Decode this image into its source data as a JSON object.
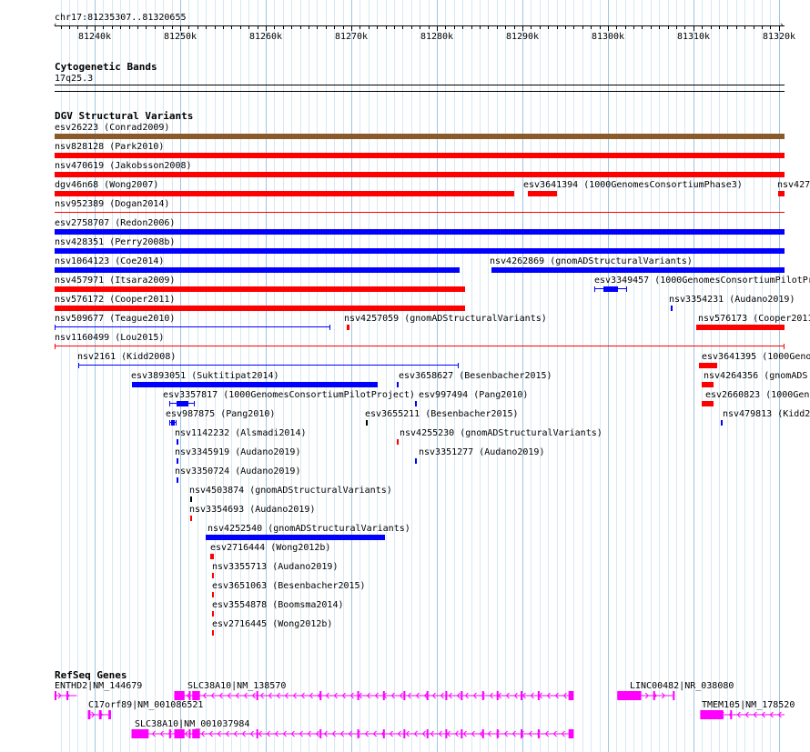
{
  "ruler": {
    "coords": "chr17:81235307..81320655",
    "start": 81235307,
    "end": 81320655,
    "ticks": [
      "81240k",
      "81250k",
      "81260k",
      "81270k",
      "81280k",
      "81290k",
      "81300k",
      "81310k",
      "81320k"
    ]
  },
  "cytobands": {
    "title": "Cytogenetic Bands",
    "band": "17q25.3"
  },
  "dgv": {
    "title": "DGV Structural Variants",
    "colors": {
      "brown": "#8b5a2b",
      "red": "#ff0000",
      "blue": "#0000ff"
    },
    "items": [
      {
        "label": "esv26223 (Conrad2009)",
        "color": "brown",
        "start": 81235307,
        "end": 81320655
      },
      {
        "label": "nsv828128 (Park2010)",
        "color": "red",
        "start": 81235307,
        "end": 81320655
      },
      {
        "label": "nsv470619 (Jakobsson2008)",
        "color": "red",
        "start": 81235307,
        "end": 81320655
      },
      {
        "label": "dgv46n68 (Wong2007)",
        "color": "red",
        "start": 81235307,
        "end": 81289100
      },
      {
        "label": "esv3641394 (1000GenomesConsortiumPhase3)",
        "color": "red",
        "start": 81290600,
        "end": 81294100
      },
      {
        "label": "nsv427",
        "color": "red",
        "start": 81319900,
        "end": 81320655
      },
      {
        "label": "nsv952389 (Dogan2014)",
        "color": "red",
        "style": "thin",
        "start": 81235307,
        "end": 81320655
      },
      {
        "label": "esv2758707 (Redon2006)",
        "color": "blue",
        "start": 81235307,
        "end": 81320655
      },
      {
        "label": "nsv428351 (Perry2008b)",
        "color": "blue",
        "start": 81235307,
        "end": 81320655
      },
      {
        "label": "nsv1064123 (Coe2014)",
        "color": "blue",
        "start": 81235307,
        "end": 81282700
      },
      {
        "label": "nsv4262869 (gnomADStructuralVariants)",
        "color": "blue",
        "start": 81286400,
        "end": 81320655
      },
      {
        "label": "nsv457971 (Itsara2009)",
        "color": "red",
        "start": 81235307,
        "end": 81283300
      },
      {
        "label": "esv3349457 (1000GenomesConsortiumPilotPr",
        "color": "blue",
        "style": "dumbbell",
        "start": 81298400,
        "end": 81302200
      },
      {
        "label": "nsv576172 (Cooper2011)",
        "color": "red",
        "start": 81235307,
        "end": 81283300
      },
      {
        "label": "nsv3354231 (Audano2019)",
        "color": "blue",
        "start": 81307400,
        "end": 81307600
      },
      {
        "label": "nsv509677 (Teague2010)",
        "color": "blue",
        "style": "dumbbell",
        "start": 81235307,
        "end": 81267600
      },
      {
        "label": "nsv4257059 (gnomADStructuralVariants)",
        "color": "red",
        "start": 81269500,
        "end": 81269800
      },
      {
        "label": "nsv576173 (Cooper2011",
        "color": "red",
        "start": 81310300,
        "end": 81320655
      },
      {
        "label": "nsv1160499 (Lou2015)",
        "color": "red",
        "style": "dumbbell",
        "start": 81235307,
        "end": 81320655
      },
      {
        "label": "nsv2161 (Kidd2008)",
        "color": "blue",
        "style": "dumbbell",
        "start": 81238100,
        "end": 81282600
      },
      {
        "label": "esv3641395 (1000Geno",
        "color": "red",
        "start": 81310700,
        "end": 81312800
      },
      {
        "label": "esv3893051 (Suktitipat2014)",
        "color": "blue",
        "start": 81244400,
        "end": 81273100
      },
      {
        "label": "esv3658627 (Besenbacher2015)",
        "color": "blue",
        "start": 81275300,
        "end": 81275500
      },
      {
        "label": "nsv4264356 (gnomADS",
        "color": "red",
        "start": 81311000,
        "end": 81312400
      },
      {
        "label": "esv3357817 (1000GenomesConsortiumPilotProject)",
        "color": "blue",
        "style": "dumbbell",
        "start": 81248700,
        "end": 81251700
      },
      {
        "label": "esv997494 (Pang2010)",
        "color": "blue",
        "start": 81277500,
        "end": 81277700
      },
      {
        "label": "esv2660823 (1000Geno",
        "color": "red",
        "start": 81311000,
        "end": 81312400
      },
      {
        "label": "esv987875 (Pang2010)",
        "color": "blue",
        "style": "dumbbell",
        "start": 81248700,
        "end": 81249600
      },
      {
        "label": "esv3655211 (Besenbacher2015)",
        "color": "black",
        "start": 81271700,
        "end": 81271900
      },
      {
        "label": "nsv479813 (Kidd2",
        "color": "blue",
        "start": 81313200,
        "end": 81313400
      },
      {
        "label": "nsv1142232 (Alsmadi2014)",
        "color": "blue",
        "start": 81249600,
        "end": 81249800
      },
      {
        "label": "nsv4255230 (gnomADStructuralVariants)",
        "color": "red",
        "start": 81275300,
        "end": 81275500
      },
      {
        "label": "nsv3345919 (Audano2019)",
        "color": "blue",
        "start": 81249600,
        "end": 81249800
      },
      {
        "label": "nsv3351277 (Audano2019)",
        "color": "blue",
        "start": 81277500,
        "end": 81277700
      },
      {
        "label": "nsv3350724 (Audano2019)",
        "color": "blue",
        "start": 81249600,
        "end": 81249800
      },
      {
        "label": "nsv4503874 (gnomADStructuralVariants)",
        "color": "black",
        "start": 81251200,
        "end": 81251400
      },
      {
        "label": "nsv3354693 (Audano2019)",
        "color": "red",
        "start": 81251200,
        "end": 81251400
      },
      {
        "label": "nsv4252540 (gnomADStructuralVariants)",
        "color": "blue",
        "start": 81253000,
        "end": 81273900
      },
      {
        "label": "esv2716444 (Wong2012b)",
        "color": "red",
        "style": "dumbbell",
        "start": 81253500,
        "end": 81253900
      },
      {
        "label": "nsv3355713 (Audano2019)",
        "color": "red",
        "start": 81253700,
        "end": 81253900
      },
      {
        "label": "esv3651063 (Besenbacher2015)",
        "color": "red",
        "start": 81253700,
        "end": 81253900
      },
      {
        "label": "esv3554878 (Boomsma2014)",
        "color": "red",
        "start": 81253700,
        "end": 81253900
      },
      {
        "label": "esv2716445 (Wong2012b)",
        "color": "red",
        "start": 81253700,
        "end": 81253900
      }
    ]
  },
  "refseq": {
    "title": "RefSeq Genes",
    "color": "#ff00ff",
    "genes": [
      {
        "label": "ENTHD2|NM_144679",
        "start": 81235307,
        "end": 81237900,
        "strand": "+",
        "exons": [
          [
            81235307,
            81235500
          ],
          [
            81236700,
            81236900
          ]
        ]
      },
      {
        "label": "SLC38A10|NM_138570",
        "start": 81249300,
        "end": 81296000,
        "strand": "-",
        "exons": [
          [
            81249300,
            81250500
          ],
          [
            81251000,
            81251200
          ],
          [
            81251400,
            81252300
          ],
          [
            81258900,
            81259100
          ],
          [
            81266300,
            81266500
          ],
          [
            81270700,
            81270900
          ],
          [
            81273700,
            81273900
          ],
          [
            81276100,
            81276300
          ],
          [
            81278800,
            81279000
          ],
          [
            81281000,
            81281200
          ],
          [
            81282800,
            81283000
          ],
          [
            81285300,
            81285500
          ],
          [
            81287000,
            81287200
          ],
          [
            81289800,
            81290000
          ],
          [
            81291800,
            81292000
          ],
          [
            81295400,
            81296000
          ]
        ]
      },
      {
        "label": "LINC00482|NR_038080",
        "start": 81301100,
        "end": 81307800,
        "strand": "+",
        "exons": [
          [
            81301100,
            81303900
          ],
          [
            81305300,
            81305500
          ],
          [
            81307600,
            81307800
          ]
        ]
      },
      {
        "label": "C17orf89|NM_001086521",
        "start": 81239200,
        "end": 81241900,
        "strand": "+",
        "exons": [
          [
            81239200,
            81239500
          ],
          [
            81240500,
            81240800
          ],
          [
            81241600,
            81241900
          ]
        ]
      },
      {
        "label": "TMEM105|NM_178520",
        "start": 81310800,
        "end": 81320655,
        "strand": "-",
        "exons": [
          [
            81310800,
            81313500
          ],
          [
            81314300,
            81314500
          ]
        ]
      },
      {
        "label": "SLC38A10|NM_001037984",
        "start": 81244300,
        "end": 81296000,
        "strand": "-",
        "exons": [
          [
            81244300,
            81246300
          ],
          [
            81248700,
            81248900
          ],
          [
            81249300,
            81250500
          ],
          [
            81251000,
            81251200
          ],
          [
            81251400,
            81252300
          ],
          [
            81258900,
            81259100
          ],
          [
            81266300,
            81266500
          ],
          [
            81270700,
            81270900
          ],
          [
            81273700,
            81273900
          ],
          [
            81276100,
            81276300
          ],
          [
            81278800,
            81279000
          ],
          [
            81281000,
            81281200
          ],
          [
            81282800,
            81283000
          ],
          [
            81285300,
            81285500
          ],
          [
            81287000,
            81287200
          ],
          [
            81289800,
            81290000
          ],
          [
            81291800,
            81292000
          ],
          [
            81295400,
            81296000
          ]
        ]
      }
    ]
  }
}
